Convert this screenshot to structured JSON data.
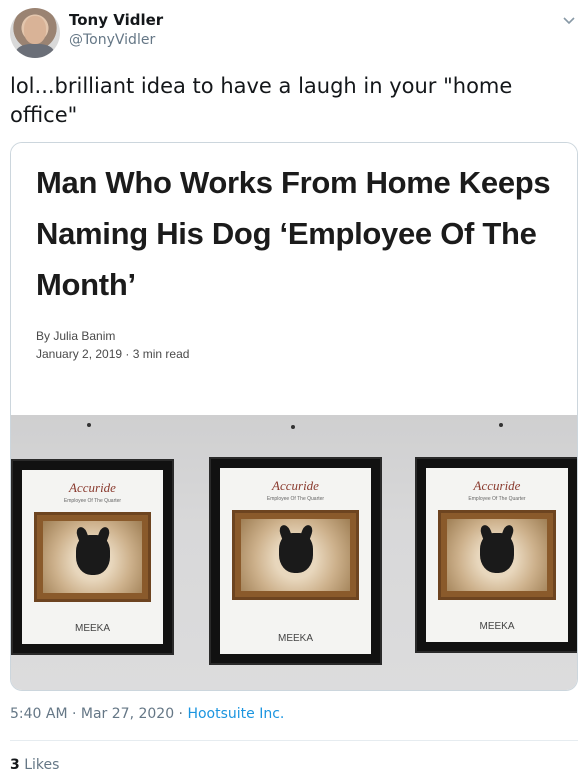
{
  "user": {
    "name": "Tony Vidler",
    "handle": "@TonyVidler"
  },
  "tweet": {
    "text": "lol...brilliant idea to have a laugh in your \"home office\""
  },
  "article": {
    "headline": "Man Who Works From Home Keeps Naming His Dog ‘Employee Of The Month’",
    "byline": "By Julia Banim",
    "date": "January 2, 2019 · 3 min read"
  },
  "plaques": [
    {
      "logo": "Accuride",
      "subtitle": "Employee Of The Quarter",
      "name": "MEEKA"
    },
    {
      "logo": "Accuride",
      "subtitle": "Employee Of The Quarter",
      "name": "MEEKA"
    },
    {
      "logo": "Accuride",
      "subtitle": "Employee Of The Quarter",
      "name": "MEEKA"
    }
  ],
  "meta": {
    "time": "5:40 AM · Mar 27, 2020 · ",
    "source": "Hootsuite Inc."
  },
  "engagement": {
    "likes_count": "3",
    "likes_label": " Likes"
  },
  "icons": {
    "menu": "chevron-down-icon"
  },
  "colors": {
    "link": "#1b95e0",
    "secondary_text": "#657786",
    "border": "#ccd6dd"
  }
}
